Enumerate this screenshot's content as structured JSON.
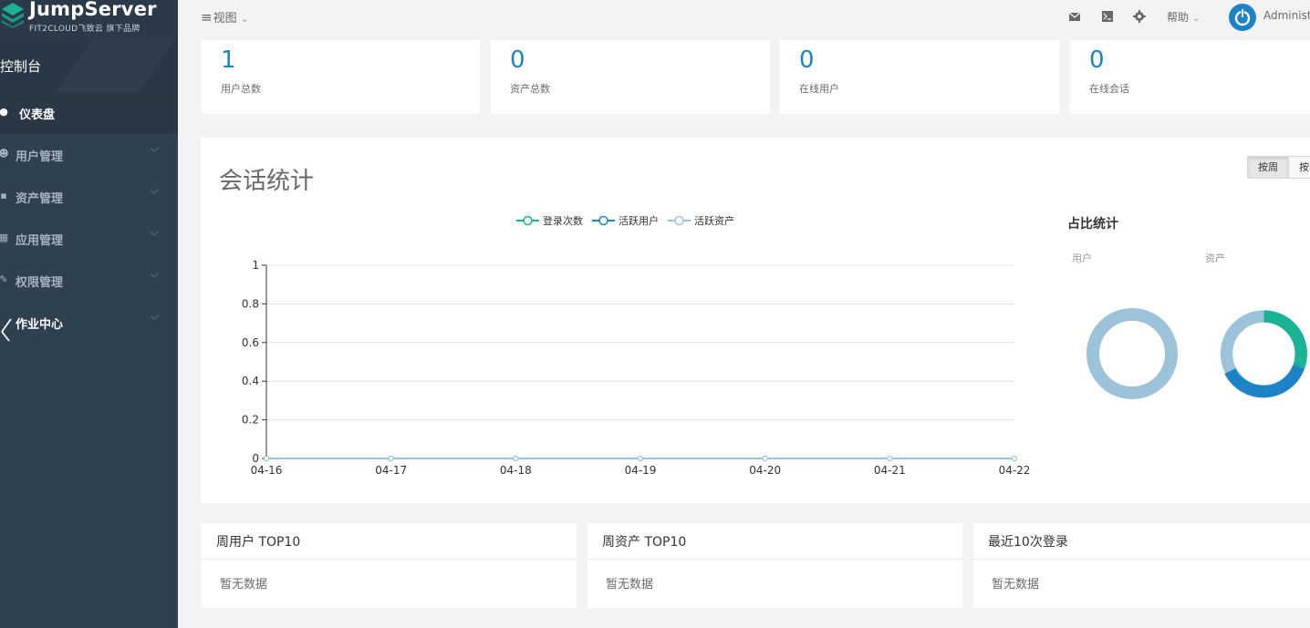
{
  "brand": {
    "name": "JumpServer",
    "sub": "FIT2CLOUD飞致云 旗下品牌",
    "console": "控制台"
  },
  "sidebar": {
    "items": [
      {
        "label": "仪表盘",
        "icon": "dashboard-icon"
      },
      {
        "label": "用户管理",
        "icon": "users-icon"
      },
      {
        "label": "资产管理",
        "icon": "inbox-icon"
      },
      {
        "label": "应用管理",
        "icon": "grid-icon"
      },
      {
        "label": "权限管理",
        "icon": "edit-icon"
      },
      {
        "label": "作业中心",
        "icon": "coffee-icon"
      }
    ]
  },
  "topbar": {
    "view_label": "视图",
    "help_label": "帮助",
    "user_label": "Administ"
  },
  "stats": [
    {
      "value": "1",
      "label": "用户总数"
    },
    {
      "value": "0",
      "label": "资产总数"
    },
    {
      "value": "0",
      "label": "在线用户"
    },
    {
      "value": "0",
      "label": "在线会话"
    }
  ],
  "session_panel": {
    "title": "会话统计",
    "toggle_week": "按周",
    "toggle_month": "按",
    "ratio_title": "占比统计",
    "ratio_users": "用户",
    "ratio_assets": "资产"
  },
  "colors": {
    "login": "#1ab394",
    "active_user": "#1c84c6",
    "active_asset": "#9cc3da"
  },
  "chart_data": {
    "type": "line",
    "categories": [
      "04-16",
      "04-17",
      "04-18",
      "04-19",
      "04-20",
      "04-21",
      "04-22"
    ],
    "series": [
      {
        "name": "登录次数",
        "values": [
          0,
          0,
          0,
          0,
          0,
          0,
          0
        ]
      },
      {
        "name": "活跃用户",
        "values": [
          0,
          0,
          0,
          0,
          0,
          0,
          0
        ]
      },
      {
        "name": "活跃资产",
        "values": [
          0,
          0,
          0,
          0,
          0,
          0,
          0
        ]
      }
    ],
    "yticks": [
      "0",
      "0.2",
      "0.4",
      "0.6",
      "0.8",
      "1"
    ],
    "ylim": [
      0,
      1
    ],
    "legend": "top-center",
    "grid": true
  },
  "bottom_cards": [
    {
      "title": "周用户 TOP10",
      "empty": "暂无数据"
    },
    {
      "title": "周资产 TOP10",
      "empty": "暂无数据"
    },
    {
      "title": "最近10次登录",
      "empty": "暂无数据"
    }
  ]
}
